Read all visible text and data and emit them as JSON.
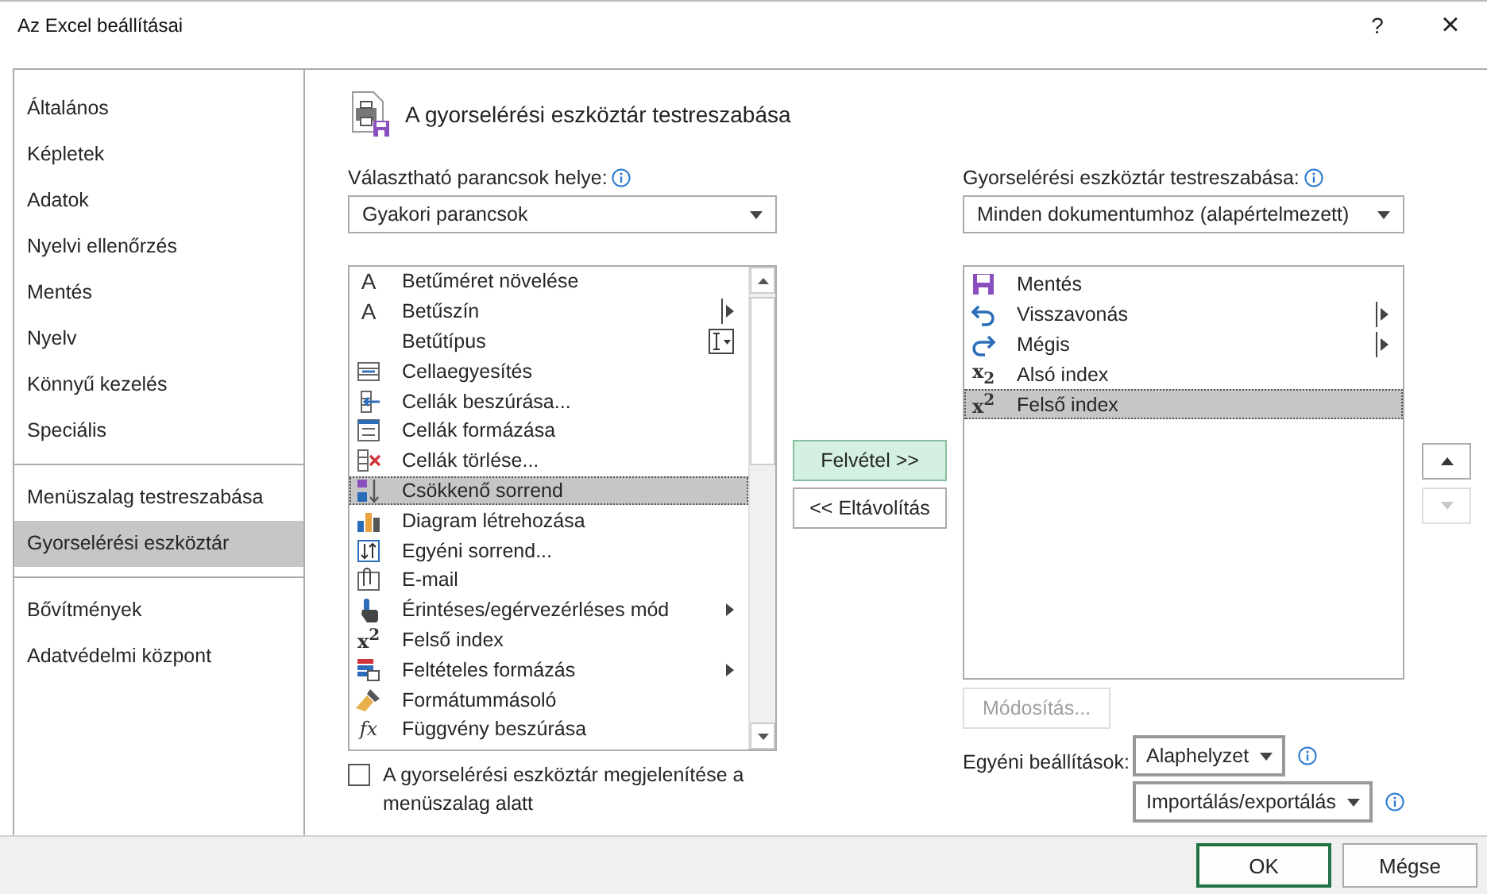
{
  "window": {
    "title": "Az Excel beállításai",
    "help": "?",
    "close": "×"
  },
  "sidebar": {
    "groups": [
      [
        {
          "label": "Általános",
          "selected": false
        },
        {
          "label": "Képletek",
          "selected": false
        },
        {
          "label": "Adatok",
          "selected": false
        },
        {
          "label": "Nyelvi ellenőrzés",
          "selected": false
        },
        {
          "label": "Mentés",
          "selected": false
        },
        {
          "label": "Nyelv",
          "selected": false
        },
        {
          "label": "Könnyű kezelés",
          "selected": false
        },
        {
          "label": "Speciális",
          "selected": false
        }
      ],
      [
        {
          "label": "Menüszalag testreszabása",
          "selected": false
        },
        {
          "label": "Gyorselérési eszköztár",
          "selected": true
        }
      ],
      [
        {
          "label": "Bővítmények",
          "selected": false
        },
        {
          "label": "Adatvédelmi központ",
          "selected": false
        }
      ]
    ]
  },
  "panel": {
    "heading": "A gyorselérési eszköztár testreszabása",
    "commands_label": "Választható parancsok helye:",
    "commands_source": "Gyakori parancsok",
    "commands": [
      {
        "label": "Betűméret növelése",
        "glyph": "A",
        "kind": "plain",
        "selected": false
      },
      {
        "label": "Betűszín",
        "glyph": "A",
        "kind": "split",
        "selected": false
      },
      {
        "label": "Betűtípus",
        "kind": "field",
        "selected": false
      },
      {
        "label": "Cellaegyesítés",
        "kind": "plain",
        "selected": false
      },
      {
        "label": "Cellák beszúrása...",
        "kind": "plain",
        "selected": false
      },
      {
        "label": "Cellák formázása",
        "kind": "plain",
        "selected": false
      },
      {
        "label": "Cellák törlése...",
        "kind": "plain",
        "selected": false
      },
      {
        "label": "Csökkenő sorrend",
        "kind": "plain",
        "selected": true
      },
      {
        "label": "Diagram létrehozása",
        "kind": "plain",
        "selected": false
      },
      {
        "label": "Egyéni sorrend...",
        "kind": "plain",
        "selected": false
      },
      {
        "label": "E-mail",
        "kind": "plain",
        "selected": false
      },
      {
        "label": "Érintéses/egérvezérléses mód",
        "kind": "submenu",
        "selected": false
      },
      {
        "label": "Felső index",
        "glyph": "x$^{2}$",
        "kind": "plain",
        "selected": false
      },
      {
        "label": "Feltételes formázás",
        "kind": "submenu",
        "selected": false
      },
      {
        "label": "Formátummásoló",
        "kind": "plain",
        "selected": false
      },
      {
        "label": "Függvény beszúrása",
        "glyph": "fx",
        "kind": "plain",
        "selected": false
      }
    ],
    "add_button": "Felvétel >>",
    "remove_button": "<< Eltávolítás",
    "toolbar_label": "Gyorselérési eszköztár testreszabása:",
    "toolbar_target": "Minden dokumentumhoz (alapértelmezett)",
    "toolbar_items": [
      {
        "label": "Mentés",
        "kind": "plain",
        "selected": false
      },
      {
        "label": "Visszavonás",
        "kind": "split",
        "selected": false
      },
      {
        "label": "Mégis",
        "kind": "split",
        "selected": false
      },
      {
        "label": "Alsó index",
        "glyph": "x$_{2}$",
        "kind": "plain",
        "selected": false
      },
      {
        "label": "Felső index",
        "glyph": "x$^{2}$",
        "kind": "plain",
        "selected": true
      }
    ],
    "move_up": {
      "disabled": false
    },
    "move_down": {
      "disabled": true
    },
    "modify_button": {
      "label": "Módosítás...",
      "disabled": true
    },
    "custom_label": "Egyéni beállítások:",
    "reset_button": "Alaphelyzet",
    "import_export_button": "Importálás/exportálás",
    "show_below": {
      "label": "A gyorselérési eszköztár megjelenítése a menüszalag alatt",
      "checked": false
    }
  },
  "footer": {
    "ok": "OK",
    "cancel": "Mégse"
  }
}
